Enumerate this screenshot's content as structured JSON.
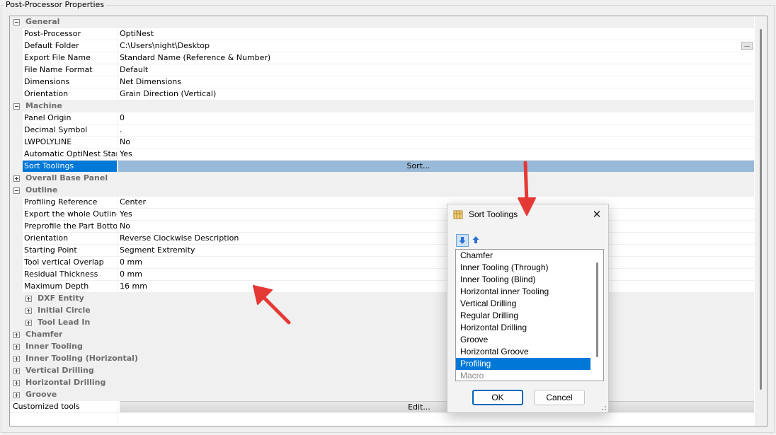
{
  "panel_title": "Post-Processor Properties",
  "categories": {
    "general": "General",
    "machine": "Machine",
    "overall_base_panel": "Overall Base Panel",
    "outline": "Outline",
    "dxf_entity": "DXF Entity",
    "initial_circle": "Initial Circle",
    "tool_lead_in": "Tool Lead In",
    "chamfer": "Chamfer",
    "inner_tooling": "Inner Tooling",
    "inner_tooling_horizontal": "Inner Tooling (Horizontal)",
    "vertical_drilling": "Vertical Drilling",
    "horizontal_drilling": "Horizontal Drilling",
    "groove": "Groove"
  },
  "general": [
    {
      "name": "Post-Processor",
      "value": "OptiNest"
    },
    {
      "name": "Default Folder",
      "value": "C:\\Users\\night\\Desktop"
    },
    {
      "name": "Export File Name",
      "value": "Standard Name (Reference & Number)"
    },
    {
      "name": "File Name Format",
      "value": "Default"
    },
    {
      "name": "Dimensions",
      "value": "Net Dimensions"
    },
    {
      "name": "Orientation",
      "value": "Grain Direction (Vertical)"
    }
  ],
  "folder_button": "...",
  "machine": [
    {
      "name": "Panel Origin",
      "value": "0"
    },
    {
      "name": "Decimal Symbol",
      "value": "."
    },
    {
      "name": "LWPOLYLINE",
      "value": "No"
    },
    {
      "name": "Automatic OptiNest Start",
      "value": "Yes"
    },
    {
      "name": "Sort Toolings",
      "value": "Sort..."
    }
  ],
  "outline": [
    {
      "name": "Profiling Reference",
      "value": "Center"
    },
    {
      "name": "Export the whole Outline",
      "value": "Yes"
    },
    {
      "name": "Preprofile the Part Bottom",
      "value": "No"
    },
    {
      "name": "Orientation",
      "value": "Reverse Clockwise Description"
    },
    {
      "name": "Starting Point",
      "value": "Segment Extremity"
    },
    {
      "name": "Tool vertical Overlap",
      "value": "0 mm"
    },
    {
      "name": "Residual Thickness",
      "value": "0 mm"
    },
    {
      "name": "Maximum Depth",
      "value": "16 mm"
    }
  ],
  "customized_tools": {
    "name": "Customized tools",
    "value": "Edit..."
  },
  "dialog": {
    "title": "Sort Toolings",
    "close": "✕",
    "items": [
      "Chamfer",
      "Inner Tooling (Through)",
      "Inner Tooling (Blind)",
      "Horizontal inner Tooling",
      "Vertical Drilling",
      "Regular Drilling",
      "Horizontal Drilling",
      "Groove",
      "Horizontal Groove",
      "Profiling",
      "Macro"
    ],
    "selected_index": 9,
    "ok": "OK",
    "cancel": "Cancel"
  },
  "colors": {
    "selection": "#0078d7",
    "selected_value_bg": "#99b9d8",
    "annotation_arrow": "#e53935",
    "category_text": "#6d6d6d"
  },
  "icons": [
    "move-down-icon",
    "move-up-icon",
    "sort-toolings-icon",
    "close-icon",
    "expand-icon",
    "collapse-icon",
    "resize-grip-icon"
  ]
}
